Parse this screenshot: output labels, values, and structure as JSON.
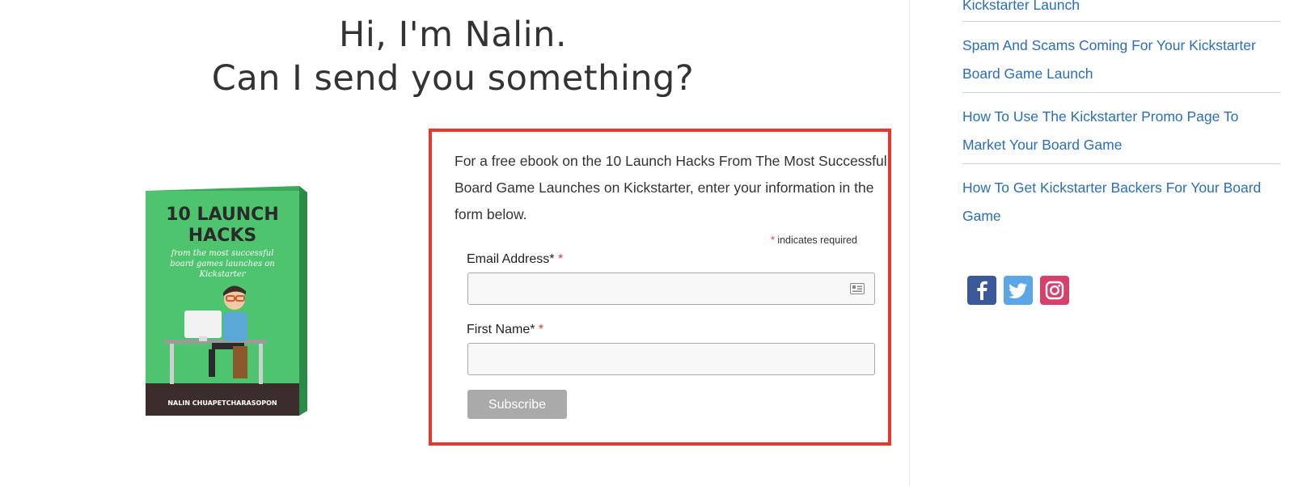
{
  "header": {
    "line1": "Hi, I'm Nalin.",
    "line2": "Can I send you something?"
  },
  "book": {
    "title_line1": "10 LAUNCH",
    "title_line2": "HACKS",
    "subtitle_line1": "from the most successful",
    "subtitle_line2": "board games launches on",
    "subtitle_line3": "Kickstarter",
    "author": "NALIN CHUAPETCHARASOPON",
    "cover_color": "#4fc46e"
  },
  "form": {
    "intro": "For a free ebook on the 10 Launch Hacks From The Most Successful Board Game Launches on Kickstarter, enter your information in the form below.",
    "required_asterisk": "*",
    "required_note": " indicates required",
    "email_label": "Email Address*",
    "email_value": "",
    "first_name_label": "First Name*",
    "first_name_value": "",
    "subscribe_label": "Subscribe",
    "border_color": "#e8382c"
  },
  "sidebar": {
    "links": [
      "Kickstarter Launch",
      "Spam And Scams Coming For Your Kickstarter",
      "Board Game Launch",
      "How To Use The Kickstarter Promo Page To",
      "Market Your Board Game",
      "How To Get Kickstarter Backers For Your Board",
      "Game"
    ],
    "social": [
      "facebook-icon",
      "twitter-icon",
      "instagram-icon"
    ],
    "link_color": "#2a6ebb"
  }
}
